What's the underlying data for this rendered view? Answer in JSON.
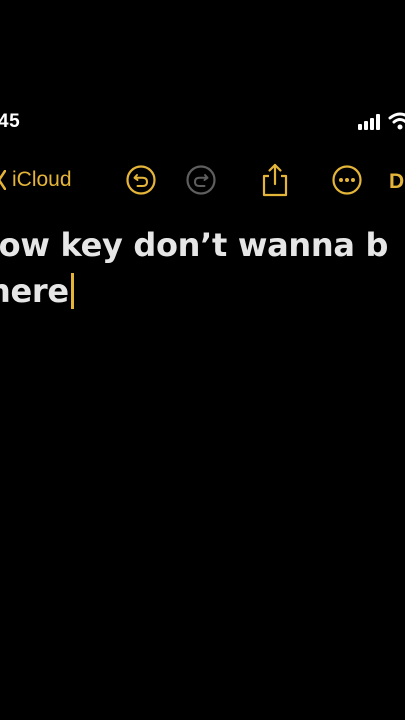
{
  "status_bar": {
    "time": "45",
    "icons": [
      "cellular-signal-icon",
      "wifi-icon"
    ]
  },
  "nav": {
    "back_label": "iCloud",
    "done_label": "D"
  },
  "toolbar": {
    "icons": [
      "undo-icon",
      "redo-icon",
      "share-icon",
      "more-icon"
    ]
  },
  "note": {
    "lines": [
      "low key don’t wanna b",
      "here"
    ]
  },
  "colors": {
    "accent": "#e5b53a",
    "background": "#000000",
    "text": "#e6e6e6",
    "disabled": "#5e5e5e"
  }
}
